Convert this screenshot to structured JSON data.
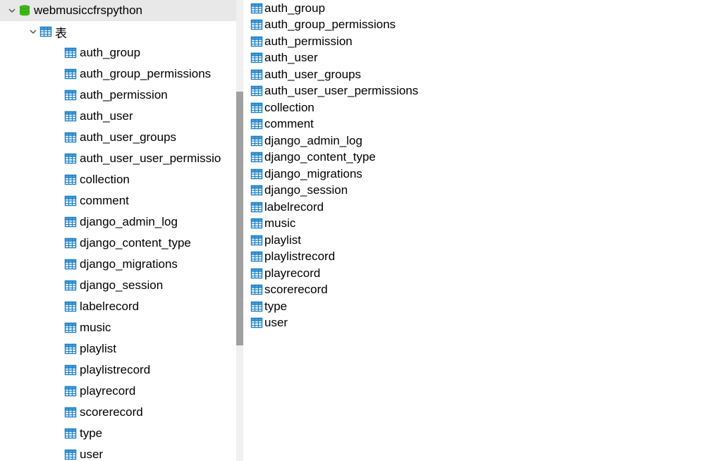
{
  "tree": {
    "database": {
      "label": "webmusiccfrspython",
      "expanded": true,
      "selected": true
    },
    "folder": {
      "label": "表",
      "expanded": true
    },
    "tables": [
      "auth_group",
      "auth_group_permissions",
      "auth_permission",
      "auth_user",
      "auth_user_groups",
      "auth_user_user_permissio",
      "collection",
      "comment",
      "django_admin_log",
      "django_content_type",
      "django_migrations",
      "django_session",
      "labelrecord",
      "music",
      "playlist",
      "playlistrecord",
      "playrecord",
      "scorerecord",
      "type",
      "user"
    ]
  },
  "listing": [
    "auth_group",
    "auth_group_permissions",
    "auth_permission",
    "auth_user",
    "auth_user_groups",
    "auth_user_user_permissions",
    "collection",
    "comment",
    "django_admin_log",
    "django_content_type",
    "django_migrations",
    "django_session",
    "labelrecord",
    "music",
    "playlist",
    "playlistrecord",
    "playrecord",
    "scorerecord",
    "type",
    "user"
  ]
}
